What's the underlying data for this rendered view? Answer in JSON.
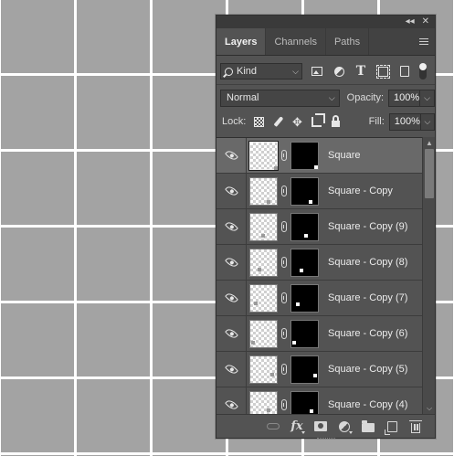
{
  "panel": {
    "title_icons": [
      "collapse-icon",
      "close-icon"
    ],
    "tabs": [
      {
        "label": "Layers",
        "active": true
      },
      {
        "label": "Channels",
        "active": false
      },
      {
        "label": "Paths",
        "active": false
      }
    ],
    "menu_icon": "hamburger-menu-icon"
  },
  "filter": {
    "kind_label": "Kind",
    "icons": [
      "pixel-filter-icon",
      "adjustment-filter-icon",
      "type-filter-icon",
      "shape-filter-icon",
      "smart-object-filter-icon"
    ],
    "toggle_on": true
  },
  "blend": {
    "mode": "Normal",
    "opacity_label": "Opacity:",
    "opacity_value": "100%"
  },
  "lock": {
    "label": "Lock:",
    "icons": [
      "lock-transparent-pixels-icon",
      "lock-image-pixels-icon",
      "lock-position-icon",
      "lock-artboard-icon",
      "lock-all-icon"
    ],
    "fill_label": "Fill:",
    "fill_value": "100%"
  },
  "layers": [
    {
      "name": "Square",
      "selected": true
    },
    {
      "name": "Square - Copy",
      "selected": false
    },
    {
      "name": "Square - Copy (9)",
      "selected": false
    },
    {
      "name": "Square - Copy (8)",
      "selected": false
    },
    {
      "name": "Square - Copy (7)",
      "selected": false
    },
    {
      "name": "Square - Copy (6)",
      "selected": false
    },
    {
      "name": "Square - Copy (5)",
      "selected": false
    },
    {
      "name": "Square - Copy (4)",
      "selected": false
    }
  ],
  "bottom_toolbar": [
    "link-layers-icon",
    "fx-icon",
    "add-mask-icon",
    "adjustment-layer-icon",
    "new-group-icon",
    "new-layer-icon",
    "delete-layer-icon"
  ],
  "colors": {
    "canvas_bg": "#a3a3a3",
    "grid_line": "#ffffff",
    "panel_bg": "#535353",
    "selected_row": "#696969"
  }
}
